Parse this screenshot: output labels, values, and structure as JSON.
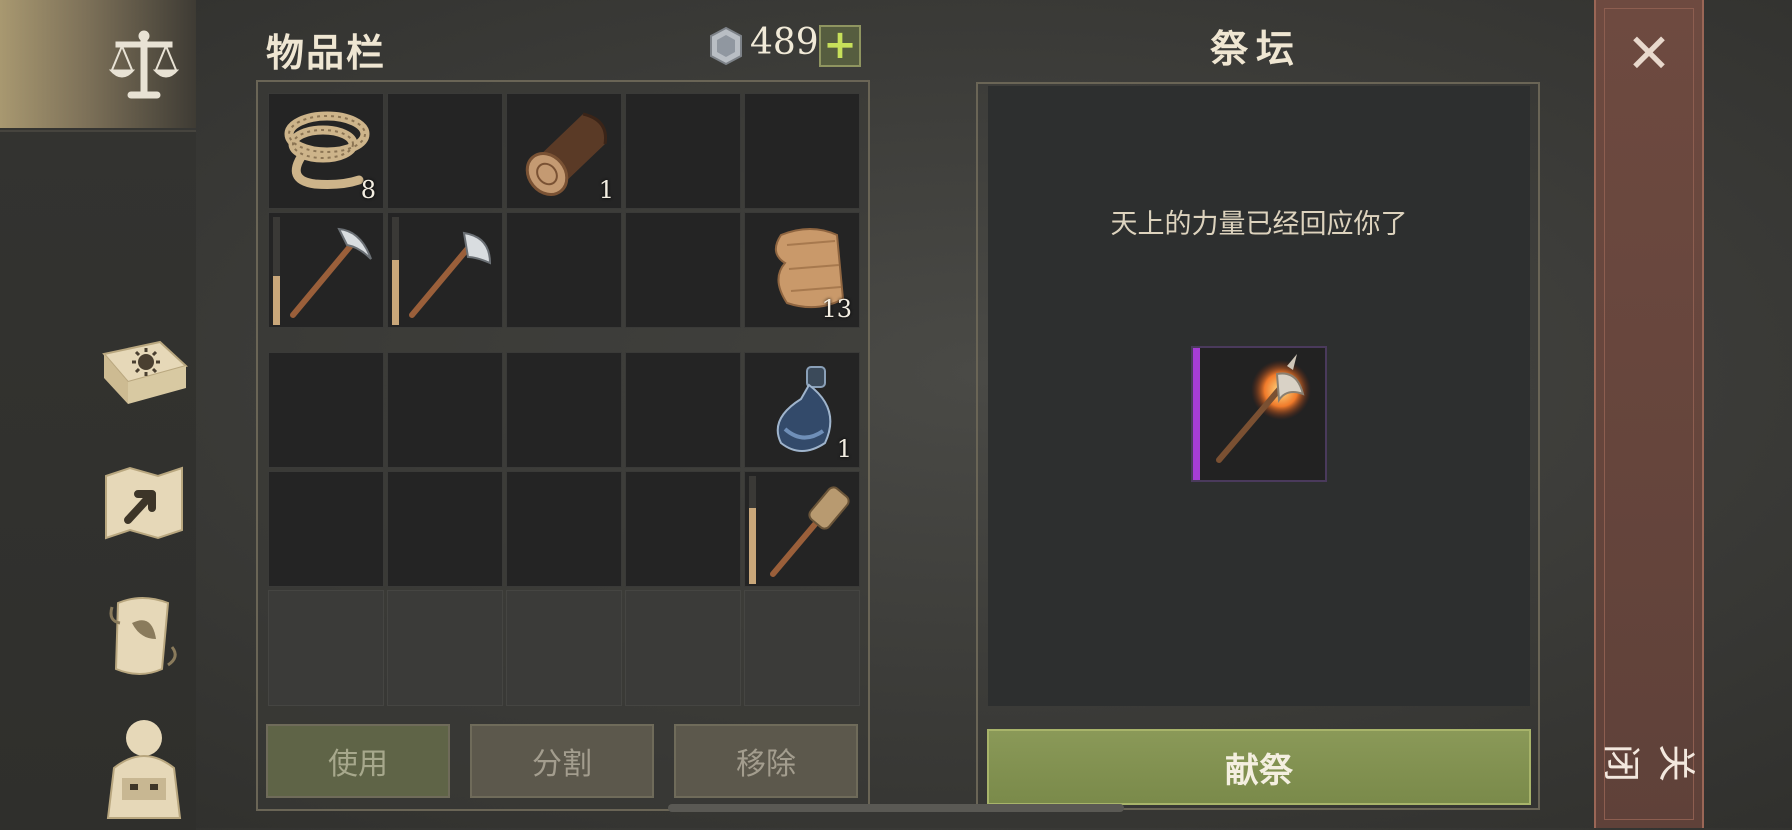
{
  "inventory": {
    "title": "物品栏",
    "currency": {
      "icon": "silver-coin-icon",
      "amount": "489",
      "add_label": "+"
    },
    "upper_slots": [
      {
        "icon": "rope-icon",
        "qty": "8"
      },
      {
        "icon": "",
        "qty": ""
      },
      {
        "icon": "log-icon",
        "qty": "1"
      },
      {
        "icon": "",
        "qty": ""
      },
      {
        "icon": "",
        "qty": ""
      },
      {
        "icon": "pickaxe-icon",
        "qty": "",
        "durability": 0.45
      },
      {
        "icon": "hatchet-icon",
        "qty": "",
        "durability": 0.6
      },
      {
        "icon": "",
        "qty": ""
      },
      {
        "icon": "",
        "qty": ""
      },
      {
        "icon": "cloth-icon",
        "qty": "13"
      }
    ],
    "lower_slots": [
      {
        "icon": "",
        "qty": ""
      },
      {
        "icon": "",
        "qty": ""
      },
      {
        "icon": "",
        "qty": ""
      },
      {
        "icon": "",
        "qty": ""
      },
      {
        "icon": "flask-icon",
        "qty": "1"
      },
      {
        "icon": "",
        "qty": ""
      },
      {
        "icon": "",
        "qty": ""
      },
      {
        "icon": "",
        "qty": ""
      },
      {
        "icon": "",
        "qty": ""
      },
      {
        "icon": "torch-icon",
        "qty": "",
        "durability": 0.7
      }
    ],
    "actions": {
      "use": "使用",
      "split": "分割",
      "remove": "移除"
    }
  },
  "altar": {
    "title": "祭坛",
    "message": "天上的力量已经回应你了",
    "reward_icon": "flaming-axe-icon",
    "rarity_color": "#a63dd6",
    "offer_label": "献祭"
  },
  "close": {
    "label": "关闭",
    "icon": "close-icon"
  },
  "nav": [
    "scales-icon",
    "journal-icon",
    "map-icon",
    "scroll-icon",
    "backpack-icon"
  ],
  "colors": {
    "offer_button": "#7f9050",
    "close_column": "#674640"
  }
}
